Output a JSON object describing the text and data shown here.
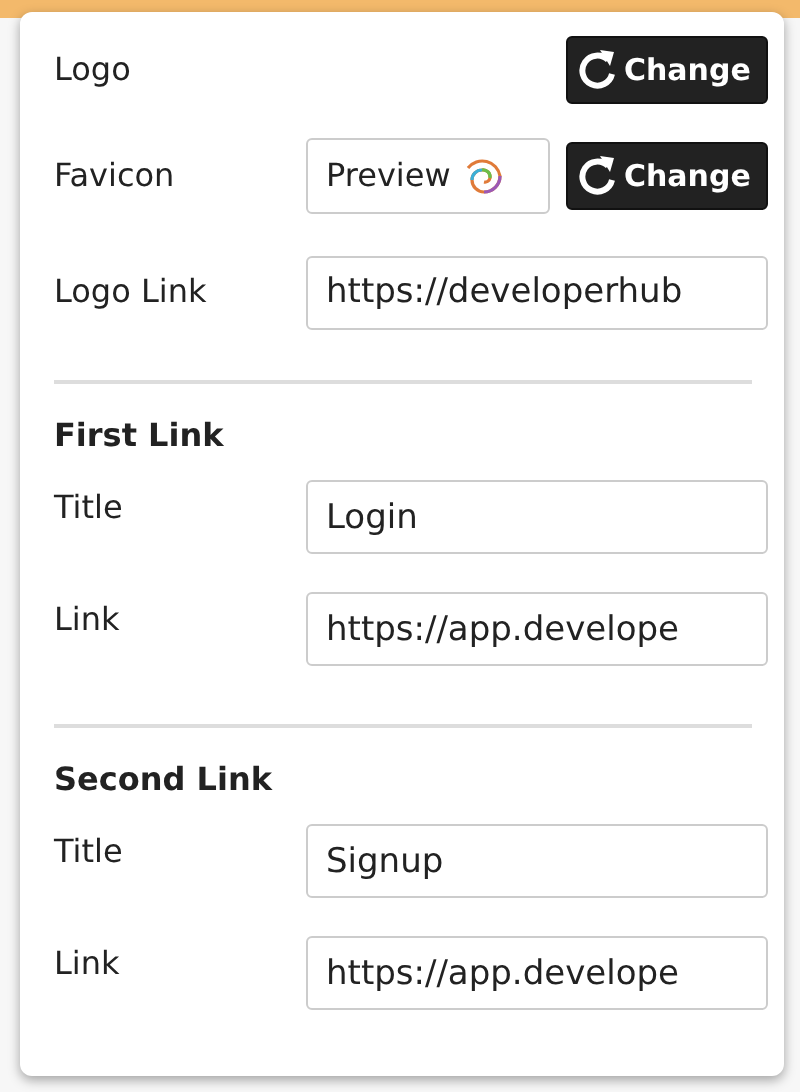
{
  "branding": {
    "logo": {
      "label": "Logo",
      "button": "Change"
    },
    "favicon": {
      "label": "Favicon",
      "preview": "Preview",
      "button": "Change"
    },
    "logo_link": {
      "label": "Logo Link",
      "value": "https://developerhub"
    }
  },
  "sections": [
    {
      "heading": "First Link",
      "fields": [
        {
          "label": "Title",
          "value": "Login"
        },
        {
          "label": "Link",
          "value": "https://app.develope"
        }
      ]
    },
    {
      "heading": "Second Link",
      "fields": [
        {
          "label": "Title",
          "value": "Signup"
        },
        {
          "label": "Link",
          "value": "https://app.develope"
        }
      ]
    }
  ]
}
